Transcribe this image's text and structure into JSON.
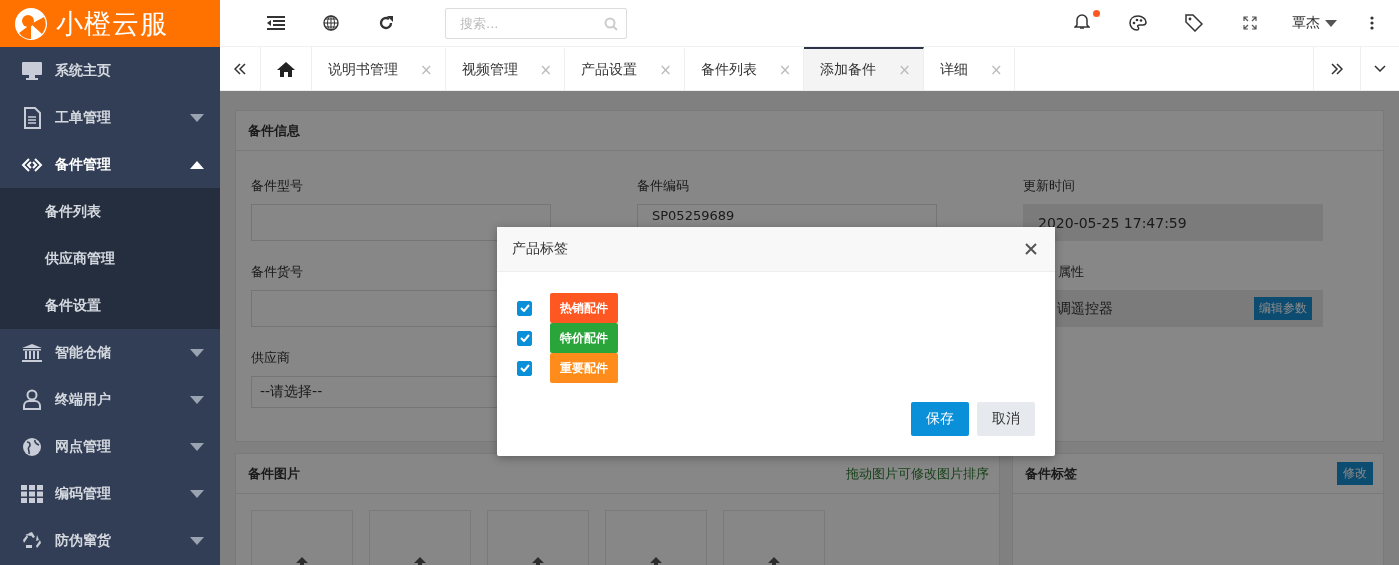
{
  "logo": {
    "text": "小橙云服"
  },
  "sidebar": {
    "items": [
      {
        "label": "系统主页"
      },
      {
        "label": "工单管理",
        "expanded": false
      },
      {
        "label": "备件管理",
        "expanded": true,
        "children": [
          {
            "label": "备件列表"
          },
          {
            "label": "供应商管理"
          },
          {
            "label": "备件设置"
          }
        ]
      },
      {
        "label": "智能仓储",
        "expanded": false
      },
      {
        "label": "终端用户",
        "expanded": false
      },
      {
        "label": "网点管理",
        "expanded": false
      },
      {
        "label": "编码管理",
        "expanded": false
      },
      {
        "label": "防伪窜货",
        "expanded": false
      }
    ]
  },
  "header": {
    "search": {
      "placeholder": "搜索..."
    },
    "notifications": {
      "unread": true
    },
    "user": "覃杰"
  },
  "tabs": [
    {
      "label": "说明书管理",
      "selected": false
    },
    {
      "label": "视频管理",
      "selected": false
    },
    {
      "label": "产品设置",
      "selected": false
    },
    {
      "label": "备件列表",
      "selected": false
    },
    {
      "label": "添加备件",
      "selected": true
    },
    {
      "label": "详细",
      "selected": false
    }
  ],
  "tab_close": "×",
  "info_card": {
    "title": "备件信息",
    "columns": [
      [
        {
          "label": "备件型号",
          "disabled": false,
          "kind": "input"
        },
        {
          "label": "备件货号",
          "disabled": false,
          "kind": "input"
        },
        {
          "label": "供应商",
          "value": "--请选择--",
          "kind": "select"
        }
      ],
      [
        {
          "label": "备件编码",
          "value": "SP05259689",
          "disabled": false,
          "kind": "input"
        }
      ],
      [
        {
          "label": "更新时间",
          "value": "2020-05-25 17:47:59",
          "disabled": true,
          "kind": "input"
        },
        {
          "label": "属性",
          "value": "调遥控器",
          "disabled": true,
          "kind": "params",
          "button": "编辑参数"
        }
      ]
    ]
  },
  "images_card": {
    "title": "备件图片",
    "hint": "拖动图片可修改图片排序",
    "slots": [
      {
        "kind": "upload"
      },
      {
        "kind": "upload"
      },
      {
        "kind": "upload"
      },
      {
        "kind": "upload"
      },
      {
        "kind": "upload"
      }
    ]
  },
  "tags_card": {
    "title": "备件标签",
    "button": "修改"
  },
  "modal": {
    "title": "产品标签",
    "tags": [
      {
        "label": "热销配件",
        "checked": true,
        "color": "#ff5722"
      },
      {
        "label": "特价配件",
        "checked": true,
        "color": "#2aa53a"
      },
      {
        "label": "重要配件",
        "checked": true,
        "color": "#ff8c1a"
      }
    ],
    "buttons": [
      {
        "label": "保存",
        "kind": "primary"
      },
      {
        "label": "取消",
        "kind": "secondary"
      }
    ]
  }
}
